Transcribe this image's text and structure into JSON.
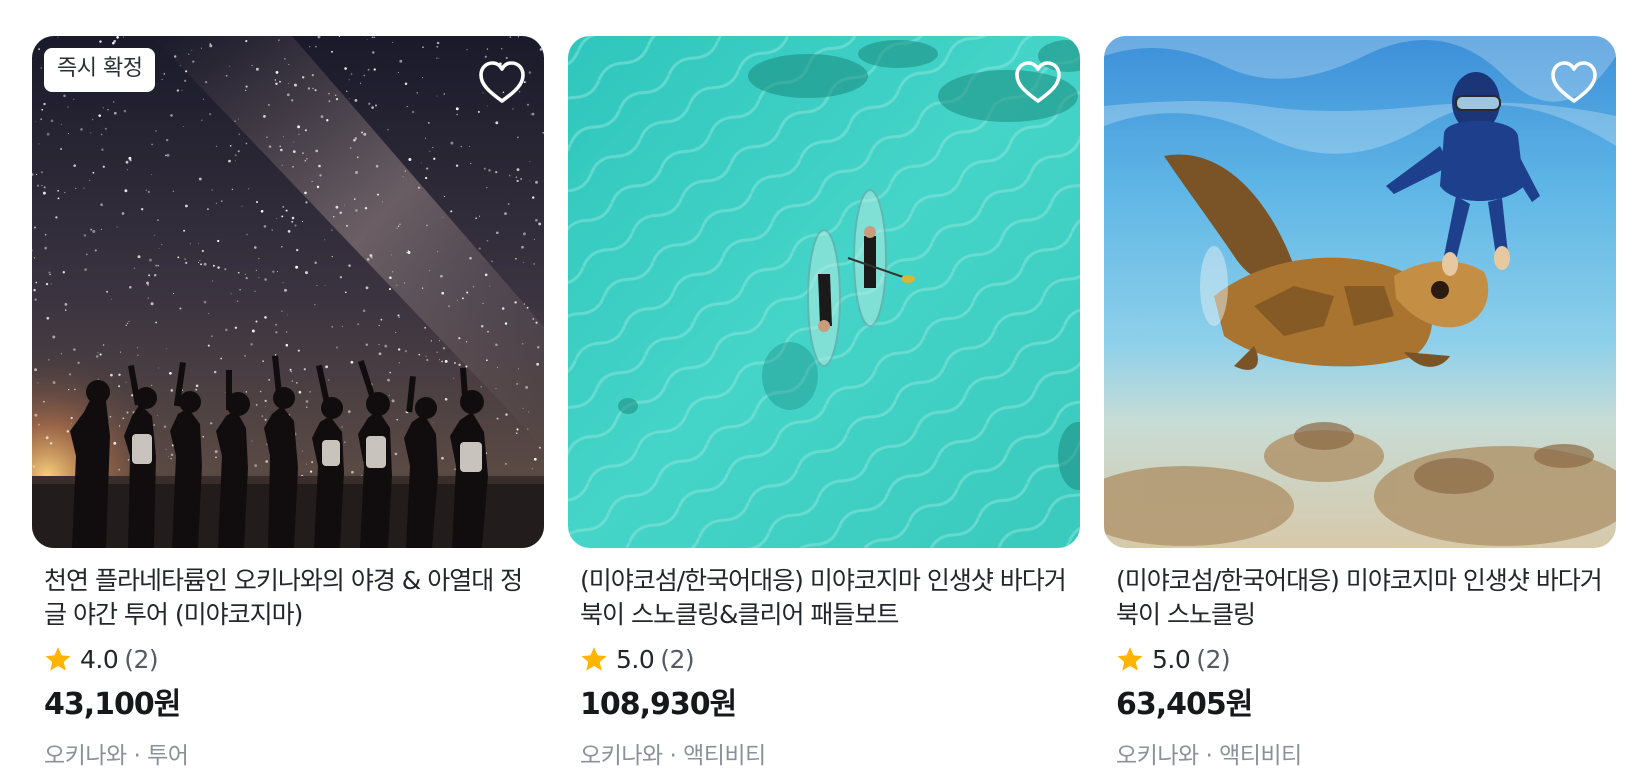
{
  "products": [
    {
      "badge": "즉시 확정",
      "title": "천연 플라네타륨인 오키나와의 야경 & 아열대 정글 야간 투어 (미야코지마)",
      "rating": "4.0",
      "review_count": "(2)",
      "price": "43,100원",
      "meta": "오키나와 · 투어",
      "image_icon": "night-sky-stargazing-photo"
    },
    {
      "title": "(미야코섬/한국어대응) 미야코지마 인생샷 바다거북이 스노클링&클리어 패들보트",
      "rating": "5.0",
      "review_count": "(2)",
      "price": "108,930원",
      "meta": "오키나와 · 액티비티",
      "image_icon": "clear-paddleboard-aerial-photo"
    },
    {
      "title": "(미야코섬/한국어대응) 미야코지마 인생샷 바다거북이 스노클링",
      "rating": "5.0",
      "review_count": "(2)",
      "price": "63,405원",
      "meta": "오키나와 · 액티비티",
      "image_icon": "sea-turtle-snorkeling-photo"
    }
  ],
  "icons": {
    "wishlist": "heart-outline-icon",
    "rating": "star-icon"
  },
  "colors": {
    "star": "#FFB400",
    "price": "#16181C",
    "meta": "#8B9099"
  }
}
